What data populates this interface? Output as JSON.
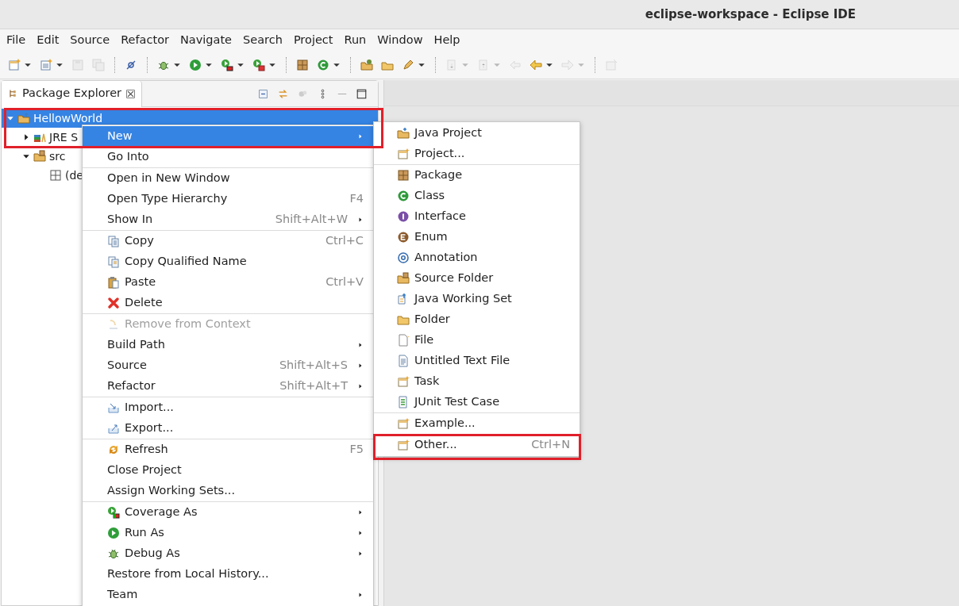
{
  "window": {
    "title": "eclipse-workspace - Eclipse IDE"
  },
  "menu_bar": [
    "File",
    "Edit",
    "Source",
    "Refactor",
    "Navigate",
    "Search",
    "Project",
    "Run",
    "Window",
    "Help"
  ],
  "toolbar": [
    {
      "kind": "icon",
      "disabled": false,
      "dropdown": true
    },
    {
      "kind": "icon",
      "disabled": false,
      "dropdown": true
    },
    {
      "kind": "icon",
      "disabled": true,
      "dropdown": false
    },
    {
      "kind": "icon",
      "disabled": true,
      "dropdown": false
    },
    {
      "kind": "separator"
    },
    {
      "kind": "icon",
      "disabled": false,
      "dropdown": false
    },
    {
      "kind": "separator"
    },
    {
      "kind": "icon",
      "disabled": false,
      "dropdown": true
    },
    {
      "kind": "icon",
      "disabled": false,
      "dropdown": true
    },
    {
      "kind": "icon",
      "disabled": false,
      "dropdown": true
    },
    {
      "kind": "icon",
      "disabled": false,
      "dropdown": true
    },
    {
      "kind": "separator"
    },
    {
      "kind": "icon",
      "disabled": false,
      "dropdown": false
    },
    {
      "kind": "icon",
      "disabled": false,
      "dropdown": true
    },
    {
      "kind": "separator"
    },
    {
      "kind": "icon",
      "disabled": false,
      "dropdown": false
    },
    {
      "kind": "icon",
      "disabled": false,
      "dropdown": false
    },
    {
      "kind": "icon",
      "disabled": false,
      "dropdown": true
    },
    {
      "kind": "separator"
    },
    {
      "kind": "icon",
      "disabled": true,
      "dropdown": true
    },
    {
      "kind": "icon",
      "disabled": true,
      "dropdown": true
    },
    {
      "kind": "icon",
      "disabled": true,
      "dropdown": false
    },
    {
      "kind": "icon",
      "disabled": false,
      "dropdown": true
    },
    {
      "kind": "icon",
      "disabled": true,
      "dropdown": true
    },
    {
      "kind": "separator"
    },
    {
      "kind": "icon",
      "disabled": true,
      "dropdown": false
    }
  ],
  "view": {
    "tab": {
      "label": "Package Explorer",
      "selected": true
    }
  },
  "tree": [
    {
      "label": "HellowWorld",
      "expanded": true,
      "selected": true,
      "highlighted": true,
      "children": [
        {
          "label": "JRE S",
          "expanded": false,
          "selected": false
        },
        {
          "label": "src",
          "expanded": true,
          "selected": false,
          "children": [
            {
              "label": "(de",
              "selected": false
            }
          ]
        }
      ]
    }
  ],
  "context_menu": [
    {
      "kind": "item",
      "label": "New",
      "submenu": true,
      "selected": true,
      "disabled": false
    },
    {
      "kind": "item",
      "label": "Go Into",
      "submenu": false,
      "selected": false,
      "disabled": false
    },
    {
      "kind": "separator"
    },
    {
      "kind": "item",
      "label": "Open in New Window",
      "submenu": false,
      "selected": false,
      "disabled": false
    },
    {
      "kind": "item",
      "label": "Open Type Hierarchy",
      "shortcut": "F4",
      "submenu": false,
      "selected": false,
      "disabled": false
    },
    {
      "kind": "item",
      "label": "Show In",
      "shortcut": "Shift+Alt+W",
      "submenu": true,
      "selected": false,
      "disabled": false
    },
    {
      "kind": "separator"
    },
    {
      "kind": "item",
      "label": "Copy",
      "shortcut": "Ctrl+C",
      "submenu": false,
      "selected": false,
      "disabled": false
    },
    {
      "kind": "item",
      "label": "Copy Qualified Name",
      "submenu": false,
      "selected": false,
      "disabled": false
    },
    {
      "kind": "item",
      "label": "Paste",
      "shortcut": "Ctrl+V",
      "submenu": false,
      "selected": false,
      "disabled": false
    },
    {
      "kind": "item",
      "label": "Delete",
      "submenu": false,
      "selected": false,
      "disabled": false
    },
    {
      "kind": "separator"
    },
    {
      "kind": "item",
      "label": "Remove from Context",
      "submenu": false,
      "selected": false,
      "disabled": true
    },
    {
      "kind": "item",
      "label": "Build Path",
      "submenu": true,
      "selected": false,
      "disabled": false
    },
    {
      "kind": "item",
      "label": "Source",
      "shortcut": "Shift+Alt+S",
      "submenu": true,
      "selected": false,
      "disabled": false
    },
    {
      "kind": "item",
      "label": "Refactor",
      "shortcut": "Shift+Alt+T",
      "submenu": true,
      "selected": false,
      "disabled": false
    },
    {
      "kind": "separator"
    },
    {
      "kind": "item",
      "label": "Import...",
      "submenu": false,
      "selected": false,
      "disabled": false
    },
    {
      "kind": "item",
      "label": "Export...",
      "submenu": false,
      "selected": false,
      "disabled": false
    },
    {
      "kind": "separator"
    },
    {
      "kind": "item",
      "label": "Refresh",
      "shortcut": "F5",
      "submenu": false,
      "selected": false,
      "disabled": false
    },
    {
      "kind": "item",
      "label": "Close Project",
      "submenu": false,
      "selected": false,
      "disabled": false
    },
    {
      "kind": "item",
      "label": "Assign Working Sets...",
      "submenu": false,
      "selected": false,
      "disabled": false
    },
    {
      "kind": "separator"
    },
    {
      "kind": "item",
      "label": "Coverage As",
      "submenu": true,
      "selected": false,
      "disabled": false
    },
    {
      "kind": "item",
      "label": "Run As",
      "submenu": true,
      "selected": false,
      "disabled": false
    },
    {
      "kind": "item",
      "label": "Debug As",
      "submenu": true,
      "selected": false,
      "disabled": false
    },
    {
      "kind": "item",
      "label": "Restore from Local History...",
      "submenu": false,
      "selected": false,
      "disabled": false
    },
    {
      "kind": "item",
      "label": "Team",
      "submenu": true,
      "selected": false,
      "disabled": false
    }
  ],
  "submenu": [
    {
      "kind": "item",
      "label": "Java Project",
      "selected": false
    },
    {
      "kind": "item",
      "label": "Project...",
      "selected": false
    },
    {
      "kind": "separator"
    },
    {
      "kind": "item",
      "label": "Package",
      "selected": false
    },
    {
      "kind": "item",
      "label": "Class",
      "selected": false
    },
    {
      "kind": "item",
      "label": "Interface",
      "selected": false
    },
    {
      "kind": "item",
      "label": "Enum",
      "selected": false
    },
    {
      "kind": "item",
      "label": "Annotation",
      "selected": false
    },
    {
      "kind": "item",
      "label": "Source Folder",
      "selected": false
    },
    {
      "kind": "item",
      "label": "Java Working Set",
      "selected": false
    },
    {
      "kind": "item",
      "label": "Folder",
      "selected": false
    },
    {
      "kind": "item",
      "label": "File",
      "selected": false
    },
    {
      "kind": "item",
      "label": "Untitled Text File",
      "selected": false
    },
    {
      "kind": "item",
      "label": "Task",
      "selected": false
    },
    {
      "kind": "item",
      "label": "JUnit Test Case",
      "selected": false
    },
    {
      "kind": "separator"
    },
    {
      "kind": "item",
      "label": "Example...",
      "selected": false
    },
    {
      "kind": "separator"
    },
    {
      "kind": "item",
      "label": "Other...",
      "shortcut": "Ctrl+N",
      "selected": false,
      "highlighted": true
    }
  ]
}
